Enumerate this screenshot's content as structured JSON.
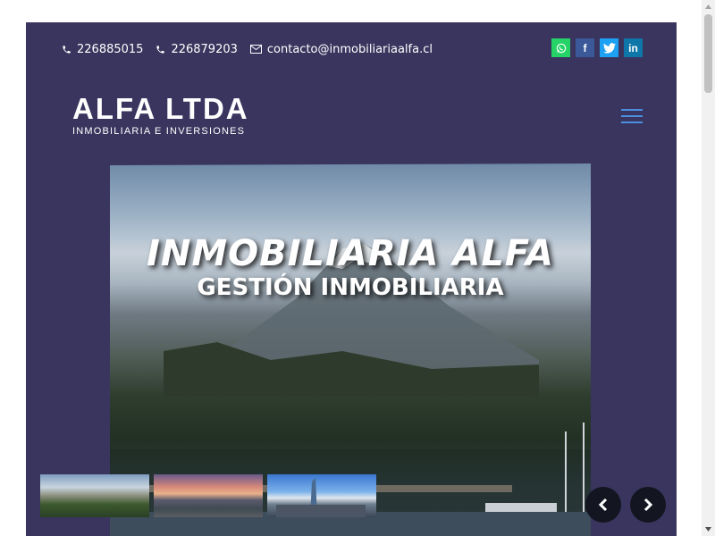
{
  "contact": {
    "phone1": "226885015",
    "phone2": "226879203",
    "email": "contacto@inmobiliariaalfa.cl"
  },
  "socials": [
    {
      "name": "whatsapp",
      "color": "#25d366",
      "glyph": "✆"
    },
    {
      "name": "facebook",
      "color": "#3b5998",
      "glyph": "f"
    },
    {
      "name": "twitter",
      "color": "#1da1f2",
      "glyph": "t"
    },
    {
      "name": "linkedin",
      "color": "#0e76a8",
      "glyph": "in"
    }
  ],
  "logo": {
    "main": "ALFA LTDA",
    "sub": "INMOBILIARIA E INVERSIONES"
  },
  "hero": {
    "title": "INMOBILIARIA ALFA",
    "subtitle": "GESTIÓN INMOBILIARIA"
  },
  "colors": {
    "background": "#3a355e",
    "accent": "#4a8fe0",
    "nav_button": "#131520"
  },
  "icons": {
    "phone": "phone-icon",
    "email": "envelope-icon",
    "menu": "hamburger-icon",
    "prev": "chevron-left-icon",
    "next": "chevron-right-icon"
  }
}
